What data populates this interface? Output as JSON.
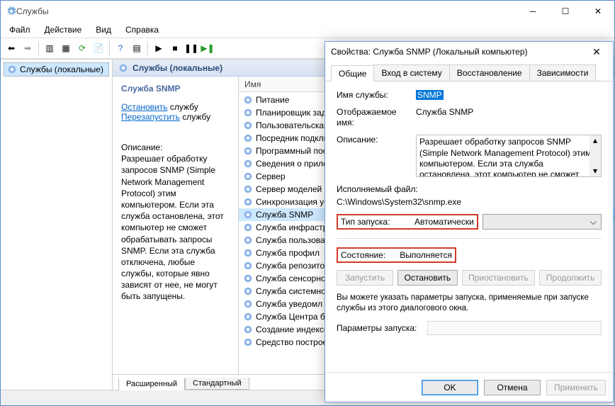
{
  "window": {
    "title": "Службы",
    "menu": {
      "file": "Файл",
      "action": "Действие",
      "view": "Вид",
      "help": "Справка"
    },
    "tree_root": "Службы (локальные)",
    "panel_header": "Службы (локальные)",
    "detail": {
      "service_name": "Служба SNMP",
      "stop_link": "Остановить",
      "restart_link": "Перезапустить",
      "link_suffix": " службу",
      "desc_label": "Описание:",
      "desc_text": "Разрешает обработку запросов SNMP (Simple Network Management Protocol) этим компьютером. Если эта служба остановлена, этот компьютер не сможет обрабатывать запросы SNMP. Если эта служба отключена, любые службы, которые явно зависят от нее, не могут быть запущены."
    },
    "list_header": "Имя",
    "services": [
      "Питание",
      "Планировщик зад",
      "Пользовательская",
      "Посредник подключений",
      "Программный поставщик",
      "Сведения о приложениях",
      "Сервер",
      "Сервер моделей",
      "Синхронизация уcтройств",
      "Служба SNMP",
      "Служба инфрастр",
      "Служба пользователя",
      "Служба профил",
      "Служба репозитор",
      "Служба сенсорной",
      "Служба системно",
      "Служба уведомл",
      "Служба Центра б",
      "Создание индексов",
      "Средство построен"
    ],
    "tabs_bottom": {
      "extended": "Расширенный",
      "standard": "Стандартный"
    }
  },
  "dialog": {
    "title": "Свойства: Служба SNMP (Локальный компьютер)",
    "tabs": {
      "general": "Общие",
      "logon": "Вход в систему",
      "recovery": "Восстановление",
      "deps": "Зависимости"
    },
    "labels": {
      "service_name": "Имя службы:",
      "display_name": "Отображаемое имя:",
      "description": "Описание:",
      "exe_path": "Исполняемый файл:",
      "startup_type": "Тип запуска:",
      "status": "Состояние:",
      "note": "Вы можете указать параметры запуска, применяемые при запуске службы из этого диалогового окна.",
      "params": "Параметры запуска:"
    },
    "values": {
      "service_name": "SNMP",
      "display_name": "Служба SNMP",
      "description": "Разрешает обработку запросов SNMP (Simple Network Management Protocol) этим компьютером. Если эта служба остановлена, этот компьютер не сможет обрабатывать",
      "exe_path": "C:\\Windows\\System32\\snmp.exe",
      "startup_type": "Автоматически",
      "status": "Выполняется"
    },
    "buttons": {
      "start": "Запустить",
      "stop": "Остановить",
      "pause": "Приостановить",
      "resume": "Продолжить",
      "ok": "OK",
      "cancel": "Отмена",
      "apply": "Применить"
    }
  }
}
